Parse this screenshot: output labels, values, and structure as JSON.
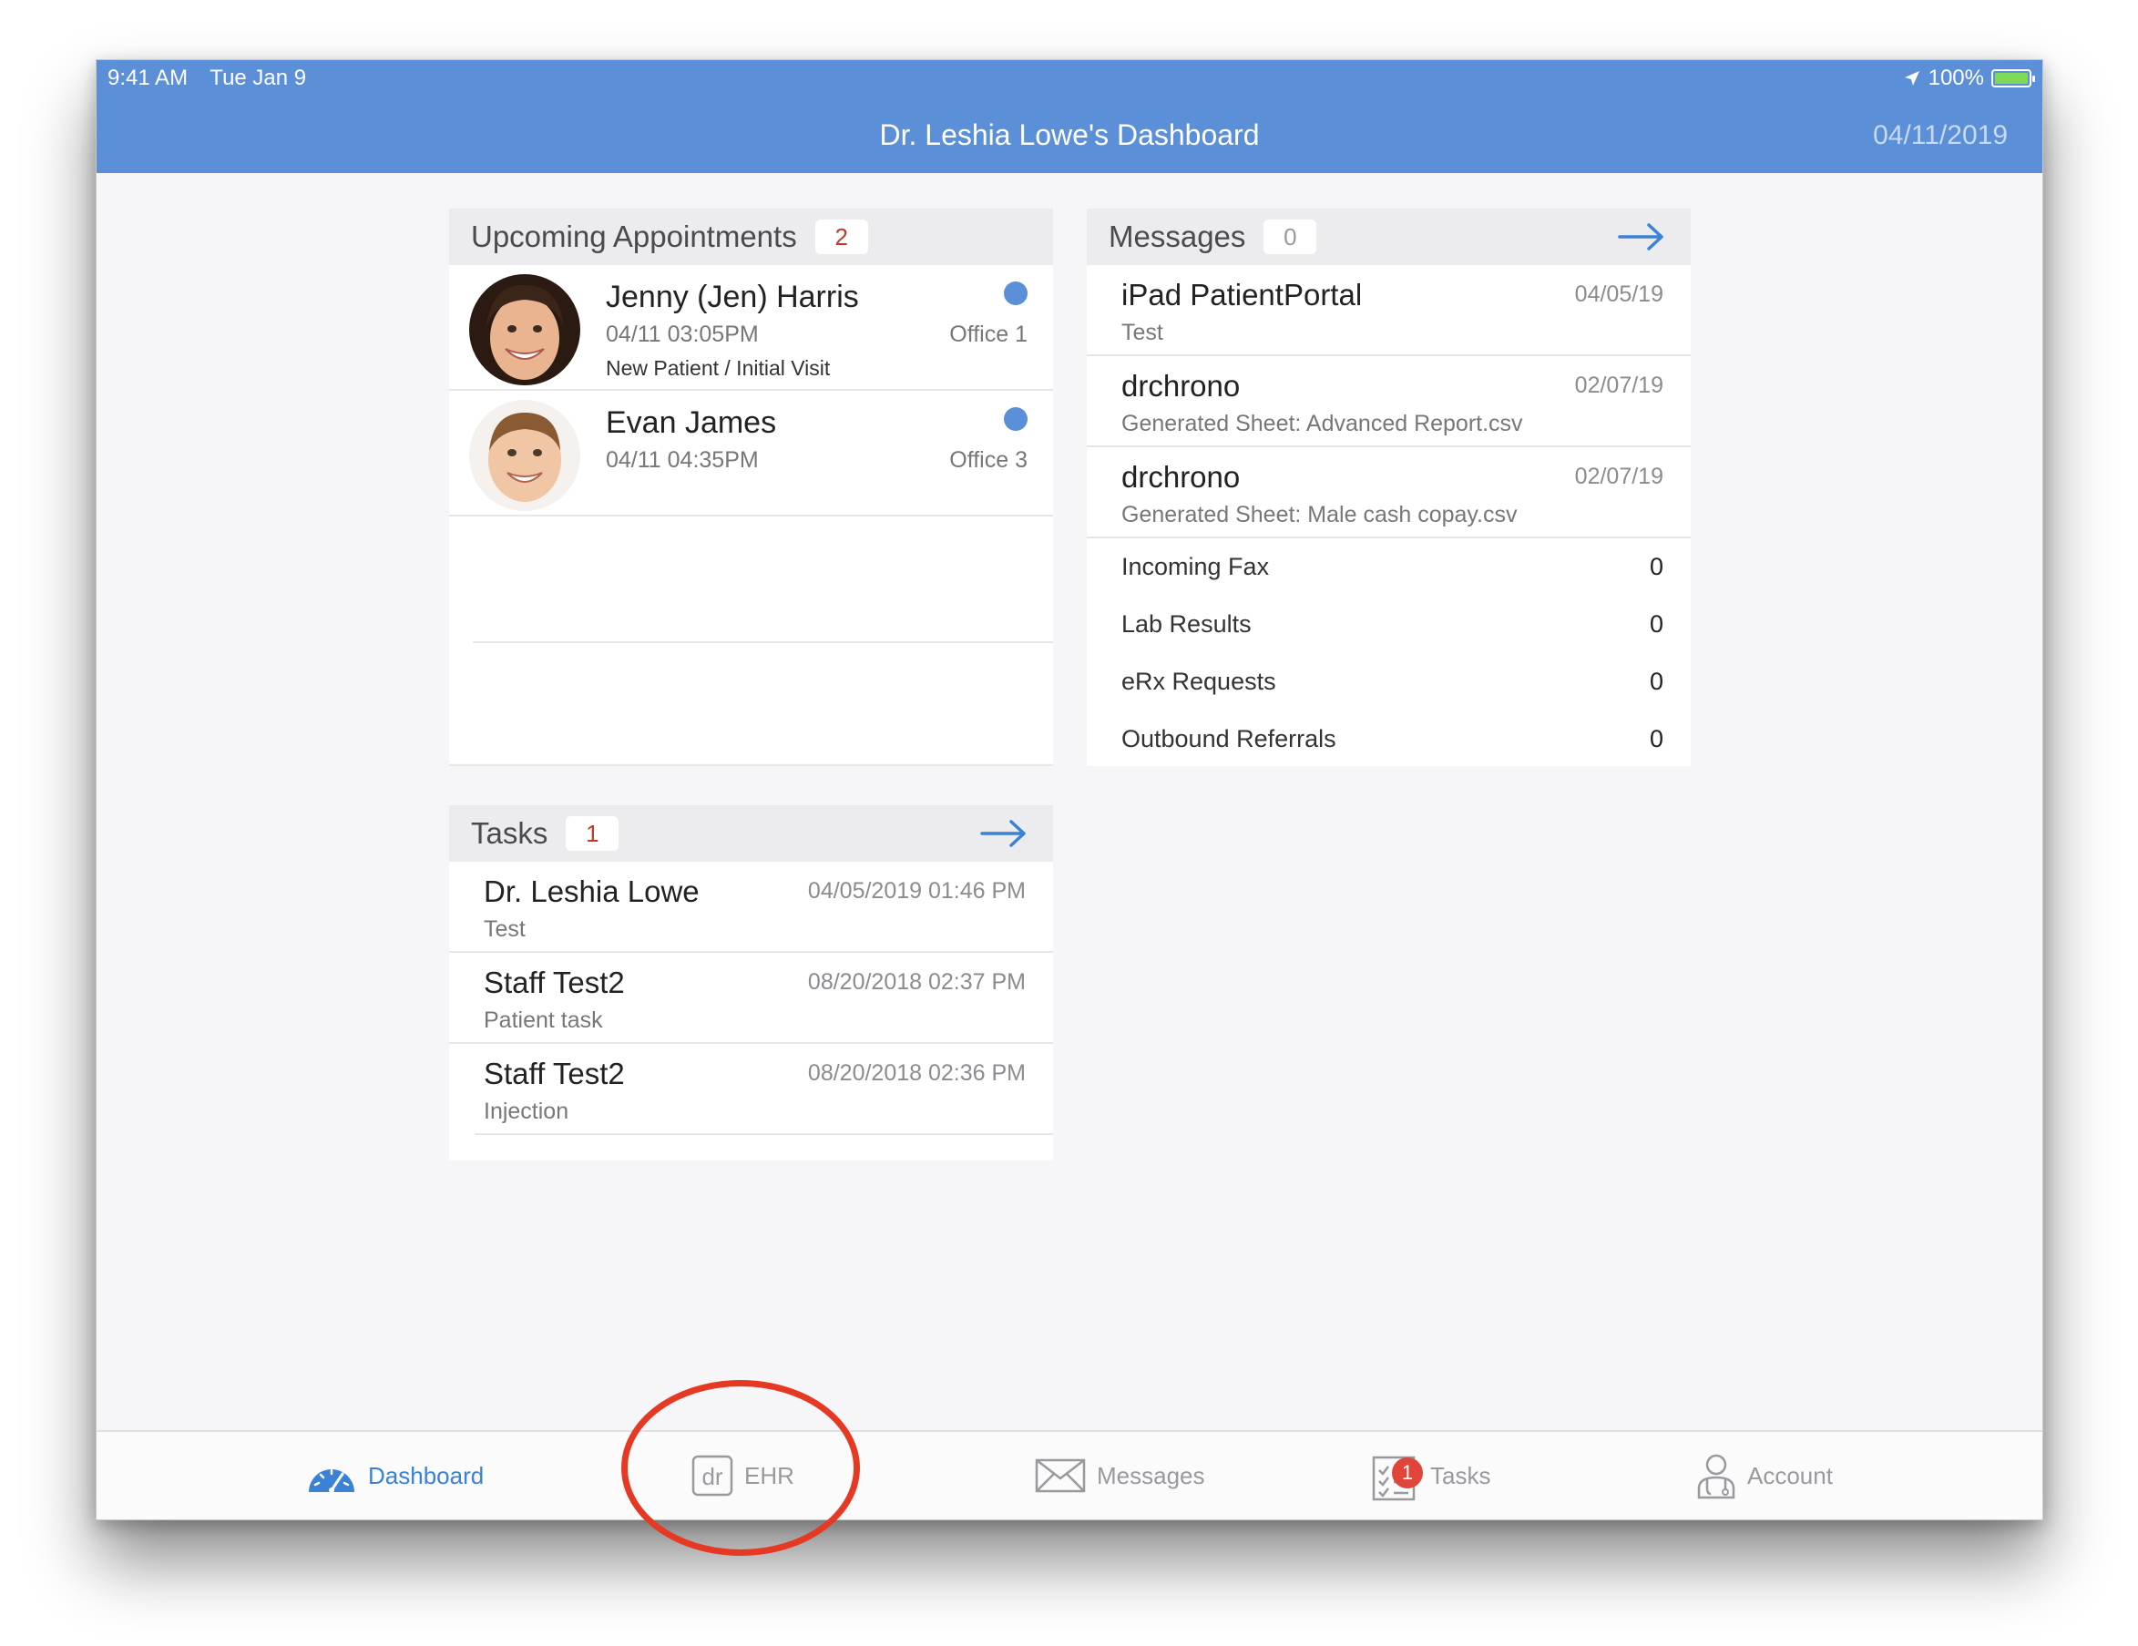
{
  "status_bar": {
    "time": "9:41 AM",
    "date": "Tue Jan 9",
    "battery": "100%"
  },
  "nav": {
    "title": "Dr. Leshia Lowe's Dashboard",
    "date": "04/11/2019"
  },
  "appointments": {
    "title": "Upcoming Appointments",
    "count": "2",
    "items": [
      {
        "name": "Jenny (Jen) Harris",
        "time": "04/11 03:05PM",
        "office": "Office 1",
        "visit": "New Patient / Initial Visit"
      },
      {
        "name": "Evan James",
        "time": "04/11 04:35PM",
        "office": "Office 3",
        "visit": ""
      }
    ]
  },
  "messages": {
    "title": "Messages",
    "count": "0",
    "items": [
      {
        "from": "iPad PatientPortal",
        "date": "04/05/19",
        "subject": "Test"
      },
      {
        "from": "drchrono",
        "date": "02/07/19",
        "subject": "Generated Sheet: Advanced Report.csv"
      },
      {
        "from": "drchrono",
        "date": "02/07/19",
        "subject": "Generated Sheet: Male cash copay.csv"
      }
    ],
    "counters": [
      {
        "label": "Incoming Fax",
        "value": "0"
      },
      {
        "label": "Lab Results",
        "value": "0"
      },
      {
        "label": "eRx Requests",
        "value": "0"
      },
      {
        "label": "Outbound Referrals",
        "value": "0"
      }
    ]
  },
  "tasks": {
    "title": "Tasks",
    "count": "1",
    "items": [
      {
        "who": "Dr. Leshia Lowe",
        "date": "04/05/2019 01:46 PM",
        "desc": "Test"
      },
      {
        "who": "Staff Test2",
        "date": "08/20/2018 02:37 PM",
        "desc": "Patient task"
      },
      {
        "who": "Staff Test2",
        "date": "08/20/2018 02:36 PM",
        "desc": "Injection"
      }
    ]
  },
  "tabbar": {
    "dashboard": "Dashboard",
    "ehr": "EHR",
    "ehr_logo": "dr",
    "messages": "Messages",
    "tasks": "Tasks",
    "tasks_badge": "1",
    "account": "Account"
  },
  "colors": {
    "accent": "#5b8fd8",
    "badge": "#e0453a",
    "annotation": "#e53924"
  }
}
